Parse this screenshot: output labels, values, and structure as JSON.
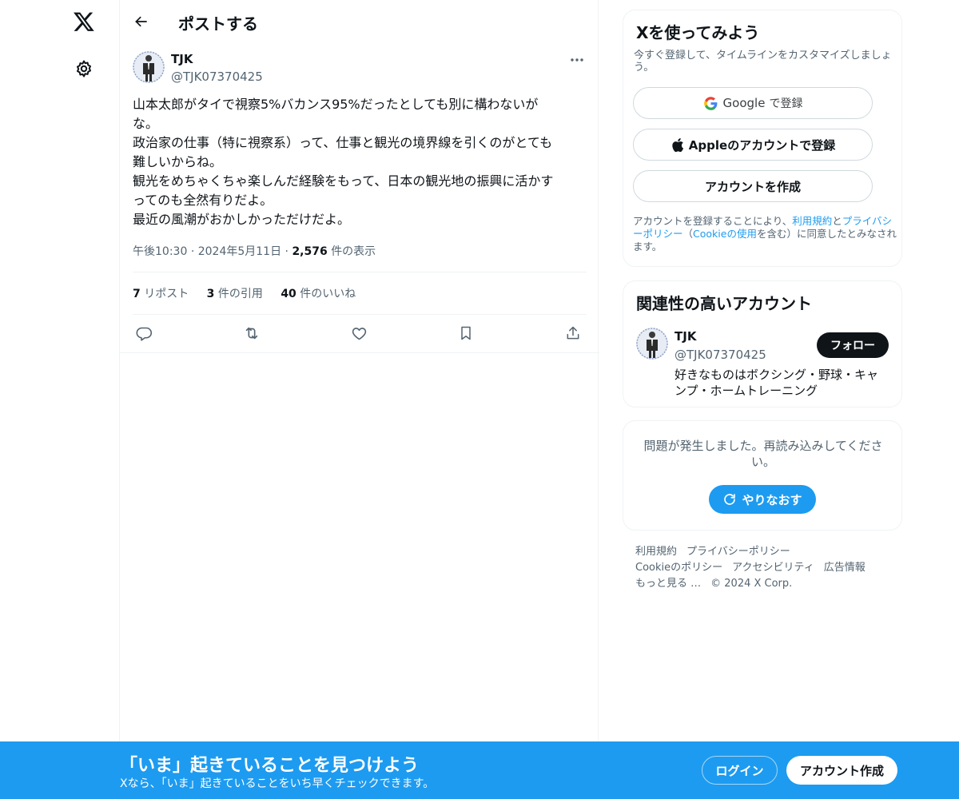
{
  "header": {
    "title": "ポストする"
  },
  "post": {
    "author_name": "TJK",
    "author_handle": "@TJK07370425",
    "text_lines": [
      "山本太郎がタイで視察5%バカンス95%だったとしても別に構わないが",
      "な。",
      "政治家の仕事（特に視察系）って、仕事と観光の境界線を引くのがとても",
      "難しいからね。",
      "観光をめちゃくちゃ楽しんだ経験をもって、日本の観光地の振興に活かす",
      "ってのも全然有りだよ。",
      "最近の風潮がおかしかっただけだよ。"
    ],
    "time": "午後10:30",
    "date": "2024年5月11日",
    "separator": "·",
    "views_count": "2,576",
    "views_label": "件の表示",
    "reposts_count": "7",
    "reposts_label": "リポスト",
    "quotes_count": "3",
    "quotes_label": "件の引用",
    "likes_count": "40",
    "likes_label": "件のいいね"
  },
  "signup_card": {
    "title": "Xを使ってみよう",
    "subtitle": "今すぐ登録して、タイムラインをカスタマイズしましょう。",
    "google_label": "Google",
    "google_suffix": "で登録",
    "apple_label": "Appleのアカウントで登録",
    "create_label": "アカウントを作成",
    "terms_prefix": "アカウントを登録することにより、",
    "terms_link": "利用規約",
    "terms_and": "と",
    "privacy_link": "プライバシーポリシー",
    "terms_paren_open": "（",
    "cookie_link": "Cookieの使用",
    "terms_suffix": "を含む）に同意したとみなされます。"
  },
  "related_card": {
    "title": "関連性の高いアカウント",
    "name": "TJK",
    "handle": "@TJK07370425",
    "bio": "好きなものはボクシング・野球・キャンプ・ホームトレーニング",
    "follow_label": "フォロー"
  },
  "error_card": {
    "message": "問題が発生しました。再読み込みしてください。",
    "retry_label": "やりなおす"
  },
  "footer": {
    "links": [
      "利用規約",
      "プライバシーポリシー",
      "Cookieのポリシー",
      "アクセシビリティ",
      "広告情報",
      "もっと見る …",
      "© 2024 X Corp."
    ]
  },
  "bottom_bar": {
    "title": "「いま」起きていることを見つけよう",
    "subtitle": "Xなら、「いま」起きていることをいち早くチェックできます。",
    "login_label": "ログイン",
    "signup_label": "アカウント作成"
  },
  "colors": {
    "accent": "#1d9bf0",
    "text": "#0f1419",
    "secondary": "#536471",
    "border": "#eff3f4"
  }
}
